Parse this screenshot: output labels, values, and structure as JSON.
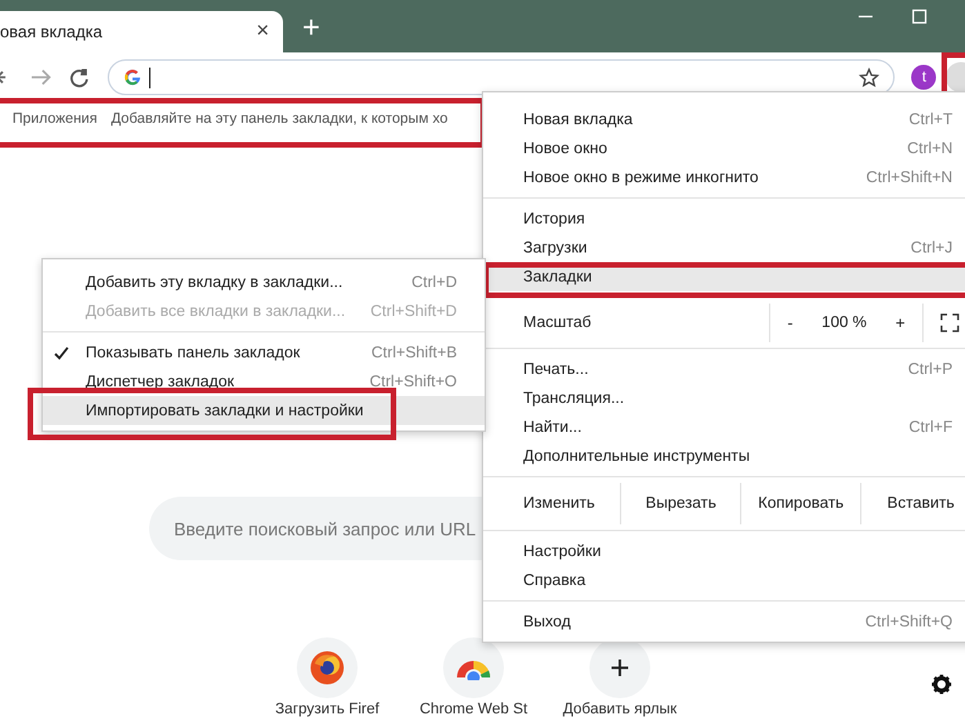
{
  "tab": {
    "title": "овая вкладка",
    "close": "×",
    "new_tab": "+"
  },
  "toolbar": {
    "avatar": "t",
    "menu_annotated": true
  },
  "bookmarks_bar": {
    "items": [
      "Приложения",
      "Добавляйте на эту панель закладки, к которым хо"
    ],
    "annotated": true
  },
  "search": {
    "placeholder": "Введите поисковый запрос или URL"
  },
  "shortcuts": [
    {
      "kind": "firefox",
      "label": "Загрузить Firef"
    },
    {
      "kind": "chrome",
      "label": "Chrome Web St"
    },
    {
      "kind": "add",
      "label": "Добавить ярлык"
    }
  ],
  "menu": [
    {
      "kind": "item",
      "label": "Новая вкладка",
      "shortcut": "Ctrl+T",
      "selected": false,
      "annotated": false
    },
    {
      "kind": "item",
      "label": "Новое окно",
      "shortcut": "Ctrl+N",
      "selected": false,
      "annotated": false
    },
    {
      "kind": "item",
      "label": "Новое окно в режиме инкогнито",
      "shortcut": "Ctrl+Shift+N",
      "selected": false,
      "annotated": false
    },
    {
      "kind": "separator"
    },
    {
      "kind": "item",
      "label": "История",
      "selected": false,
      "annotated": false
    },
    {
      "kind": "item",
      "label": "Загрузки",
      "shortcut": "Ctrl+J",
      "selected": false,
      "annotated": false
    },
    {
      "kind": "item",
      "label": "Закладки",
      "selected": true,
      "annotated": true
    },
    {
      "kind": "separator"
    },
    {
      "kind": "zoom",
      "label": "Масштаб",
      "minus": "-",
      "value": "100 %",
      "plus": "+"
    },
    {
      "kind": "separator"
    },
    {
      "kind": "item",
      "label": "Печать...",
      "shortcut": "Ctrl+P",
      "selected": false,
      "annotated": false
    },
    {
      "kind": "item",
      "label": "Трансляция...",
      "selected": false,
      "annotated": false
    },
    {
      "kind": "item",
      "label": "Найти...",
      "shortcut": "Ctrl+F",
      "selected": false,
      "annotated": false
    },
    {
      "kind": "item",
      "label": "Дополнительные инструменты",
      "selected": false,
      "annotated": false
    },
    {
      "kind": "separator"
    },
    {
      "kind": "edit",
      "label": "Изменить",
      "buttons": [
        "Вырезать",
        "Копировать",
        "Вставить"
      ]
    },
    {
      "kind": "separator"
    },
    {
      "kind": "item",
      "label": "Настройки",
      "selected": false,
      "annotated": false
    },
    {
      "kind": "item",
      "label": "Справка",
      "selected": false,
      "annotated": false
    },
    {
      "kind": "separator"
    },
    {
      "kind": "item",
      "label": "Выход",
      "shortcut": "Ctrl+Shift+Q",
      "selected": false,
      "annotated": false
    }
  ],
  "submenu": [
    {
      "kind": "item",
      "label": "Добавить эту вкладку в закладки...",
      "shortcut": "Ctrl+D",
      "disabled": false,
      "checked": false,
      "selected": false,
      "annotated": false
    },
    {
      "kind": "item",
      "label": "Добавить все вкладки в закладки...",
      "shortcut": "Ctrl+Shift+D",
      "disabled": true,
      "checked": false,
      "selected": false,
      "annotated": false
    },
    {
      "kind": "separator"
    },
    {
      "kind": "item",
      "label": "Показывать панель закладок",
      "shortcut": "Ctrl+Shift+B",
      "disabled": false,
      "checked": true,
      "selected": false,
      "annotated": false
    },
    {
      "kind": "item",
      "label": "Диспетчер закладок",
      "shortcut": "Ctrl+Shift+O",
      "disabled": false,
      "checked": false,
      "selected": false,
      "annotated": false
    },
    {
      "kind": "item",
      "label": "Импортировать закладки и настройки",
      "disabled": false,
      "checked": false,
      "selected": true,
      "annotated": true
    }
  ]
}
